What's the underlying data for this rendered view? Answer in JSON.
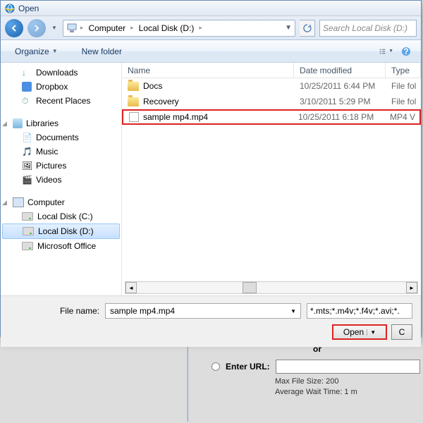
{
  "window": {
    "title": "Open"
  },
  "breadcrumbs": [
    "Computer",
    "Local Disk (D:)"
  ],
  "search": {
    "placeholder": "Search Local Disk (D:)"
  },
  "toolbar": {
    "organize": "Organize",
    "newfolder": "New folder"
  },
  "nav": {
    "favorites": [
      "Downloads",
      "Dropbox",
      "Recent Places"
    ],
    "libraries_label": "Libraries",
    "libraries": [
      "Documents",
      "Music",
      "Pictures",
      "Videos"
    ],
    "computer_label": "Computer",
    "drives": [
      "Local Disk (C:)",
      "Local Disk (D:)",
      "Microsoft Office"
    ]
  },
  "columns": {
    "name": "Name",
    "date": "Date modified",
    "type": "Type"
  },
  "files": [
    {
      "name": "Docs",
      "date": "10/25/2011 6:44 PM",
      "type": "File fol",
      "kind": "folder"
    },
    {
      "name": "Recovery",
      "date": "3/10/2011 5:29 PM",
      "type": "File fol",
      "kind": "folder"
    },
    {
      "name": "sample mp4.mp4",
      "date": "10/25/2011 6:18 PM",
      "type": "MP4 V",
      "kind": "file",
      "highlighted": true
    }
  ],
  "filename": {
    "label": "File name:",
    "value": "sample mp4.mp4"
  },
  "filter": "*.mts;*.m4v;*.f4v;*.avi;*.",
  "buttons": {
    "open": "Open",
    "cancel": "C"
  },
  "behind": {
    "or": "or",
    "enter_url": "Enter URL:",
    "max": "Max File Size: 200",
    "wait": "Average Wait Time: 1 m"
  }
}
